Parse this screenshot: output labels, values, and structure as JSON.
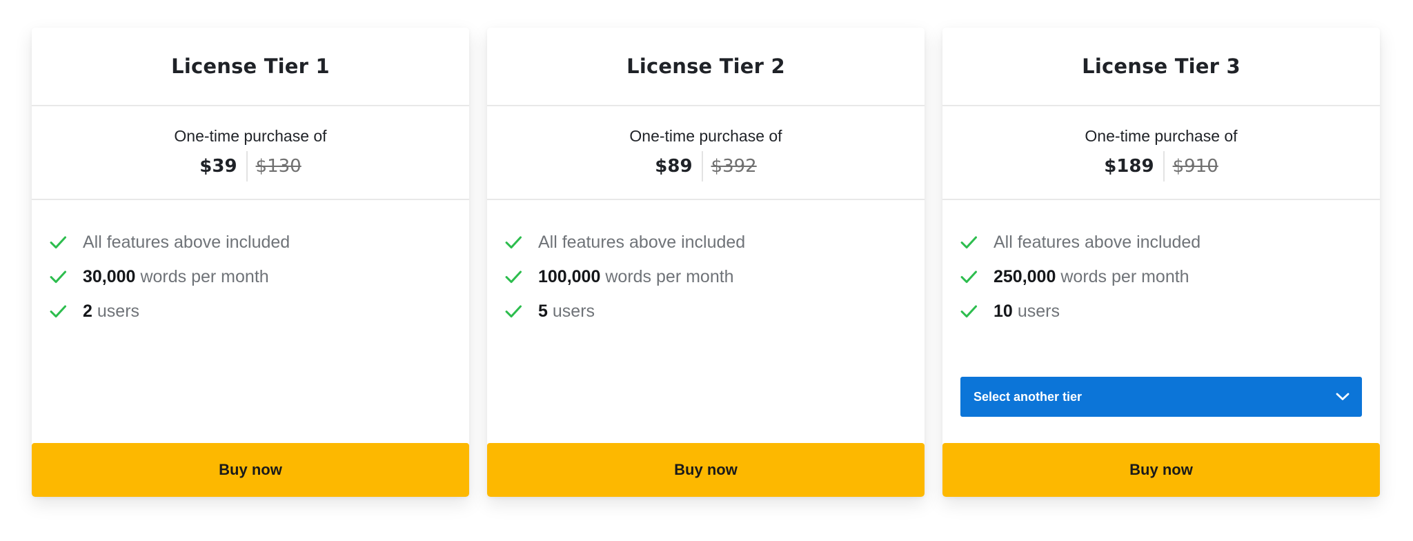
{
  "colors": {
    "accent_yellow": "#fdb800",
    "select_blue": "#0c75d8",
    "check_green": "#2dbd4e",
    "text_dark": "#1f2227",
    "text_muted": "#6f7378"
  },
  "tiers": [
    {
      "title": "License Tier 1",
      "price_caption": "One-time purchase of",
      "price_current": "$39",
      "price_old": "$130",
      "features": [
        {
          "icon": "check-icon",
          "strong": "",
          "text": "All features above included"
        },
        {
          "icon": "check-icon",
          "strong": "30,000",
          "text": "words per month"
        },
        {
          "icon": "check-icon",
          "strong": "2",
          "text": "users"
        }
      ],
      "buy_label": "Buy now"
    },
    {
      "title": "License Tier 2",
      "price_caption": "One-time purchase of",
      "price_current": "$89",
      "price_old": "$392",
      "features": [
        {
          "icon": "check-icon",
          "strong": "",
          "text": "All features above included"
        },
        {
          "icon": "check-icon",
          "strong": "100,000",
          "text": "words per month"
        },
        {
          "icon": "check-icon",
          "strong": "5",
          "text": "users"
        }
      ],
      "buy_label": "Buy now"
    },
    {
      "title": "License Tier 3",
      "price_caption": "One-time purchase of",
      "price_current": "$189",
      "price_old": "$910",
      "features": [
        {
          "icon": "check-icon",
          "strong": "",
          "text": "All features above included"
        },
        {
          "icon": "check-icon",
          "strong": "250,000",
          "text": "words per month"
        },
        {
          "icon": "check-icon",
          "strong": "10",
          "text": "users"
        }
      ],
      "select_label": "Select another tier",
      "select_icon": "chevron-down-icon",
      "buy_label": "Buy now"
    }
  ]
}
